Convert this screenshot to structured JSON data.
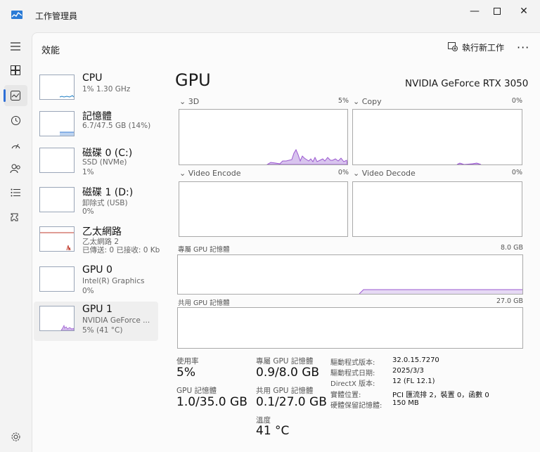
{
  "window": {
    "title": "工作管理員",
    "controls": [
      "minimize",
      "maximize",
      "close"
    ]
  },
  "nav": {
    "items": [
      {
        "name": "menu-icon"
      },
      {
        "name": "processes-icon"
      },
      {
        "name": "performance-icon",
        "selected": true
      },
      {
        "name": "app-history-icon"
      },
      {
        "name": "startup-apps-icon"
      },
      {
        "name": "users-icon"
      },
      {
        "name": "details-icon"
      },
      {
        "name": "services-icon"
      }
    ],
    "settings": "settings-icon"
  },
  "header": {
    "title": "效能",
    "run_task_label": "執行新工作",
    "more_label": "···"
  },
  "devices": [
    {
      "name": "CPU",
      "line1": "1% 1.30 GHz",
      "line2": ""
    },
    {
      "name": "記憶體",
      "line1": "6.7/47.5 GB (14%)",
      "line2": ""
    },
    {
      "name": "磁碟 0 (C:)",
      "line1": "SSD (NVMe)",
      "line2": "1%"
    },
    {
      "name": "磁碟 1 (D:)",
      "line1": "卸除式 (USB)",
      "line2": "0%"
    },
    {
      "name": "乙太網路",
      "line1": "乙太網路 2",
      "line2": "已傳送: 0 已接收: 0 Kbps"
    },
    {
      "name": "GPU 0",
      "line1": "Intel(R) Graphics",
      "line2": "0%"
    },
    {
      "name": "GPU 1",
      "line1": "NVIDIA GeForce ...",
      "line2": "5% (41 °C)",
      "selected": true
    }
  ],
  "detail": {
    "title": "GPU",
    "model": "NVIDIA GeForce RTX 3050",
    "engines": [
      {
        "label": "3D",
        "percent": "5%"
      },
      {
        "label": "Copy",
        "percent": "0%"
      },
      {
        "label": "Video Encode",
        "percent": "0%"
      },
      {
        "label": "Video Decode",
        "percent": "0%"
      }
    ],
    "dedicated_memory": {
      "label": "專屬 GPU 記憶體",
      "max": "8.0 GB"
    },
    "shared_memory": {
      "label": "共用 GPU 記憶體",
      "max": "27.0 GB"
    },
    "stats": {
      "utilization": {
        "label": "使用率",
        "value": "5%"
      },
      "dedicated": {
        "label": "專屬 GPU 記憶體",
        "value": "0.9/8.0 GB"
      },
      "gpu_memory": {
        "label": "GPU 記憶體",
        "value": "1.0/35.0 GB"
      },
      "shared": {
        "label": "共用 GPU 記憶體",
        "value": "0.1/27.0 GB"
      },
      "temperature": {
        "label": "溫度",
        "value": "41 °C"
      }
    },
    "info": [
      {
        "key": "驅動程式版本:",
        "value": "32.0.15.7270"
      },
      {
        "key": "驅動程式日期:",
        "value": "2025/3/3"
      },
      {
        "key": "DirectX 版本:",
        "value": "12 (FL 12.1)"
      },
      {
        "key": "實體位置:",
        "value": "PCI 匯流排 2，裝置 0，函數 0"
      },
      {
        "key": "硬體保留記憶體:",
        "value": "150 MB"
      }
    ]
  },
  "colors": {
    "accent": "#2f6fd6",
    "gpu_line": "#9b59d0",
    "gpu_fill": "#d8c4ee",
    "cpu_line": "#1f7fc4",
    "memory_line": "#3b7fd6",
    "ethernet_line": "#c0392b"
  }
}
